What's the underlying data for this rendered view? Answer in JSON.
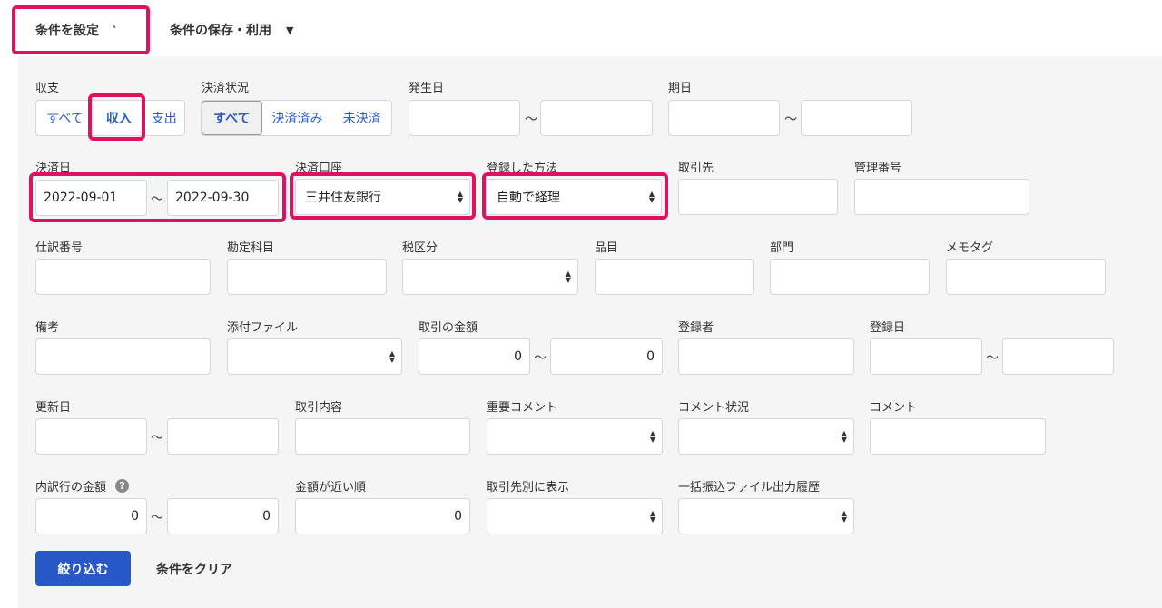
{
  "tabs": {
    "conditions": "条件を設定",
    "save_use": "条件の保存・利用"
  },
  "labels": {
    "income_expense": "収支",
    "settlement_status": "決済状況",
    "issue_date": "発生日",
    "due_date": "期日",
    "settlement_date": "決済日",
    "settlement_account": "決済口座",
    "registration_method": "登録した方法",
    "partner": "取引先",
    "management_no": "管理番号",
    "journal_no": "仕訳番号",
    "account_item": "勘定科目",
    "tax_category": "税区分",
    "item": "品目",
    "department": "部門",
    "memo_tag": "メモタグ",
    "remarks": "備考",
    "attachment": "添付ファイル",
    "amount": "取引の金額",
    "registrant": "登録者",
    "registered_date": "登録日",
    "updated_date": "更新日",
    "transaction_content": "取引内容",
    "important_comment": "重要コメント",
    "comment_status": "コメント状況",
    "comment": "コメント",
    "breakdown_amount": "内訳行の金額",
    "amount_nearest": "金額が近い順",
    "by_partner": "取引先別に表示",
    "bulk_transfer_history": "一括振込ファイル出力履歴"
  },
  "income_expense_options": [
    "すべて",
    "収入",
    "支出"
  ],
  "settlement_status_options": [
    "すべて",
    "決済済み",
    "未決済"
  ],
  "values": {
    "settlement_date_from": "2022-09-01",
    "settlement_date_to": "2022-09-30",
    "settlement_account": "三井住友銀行",
    "registration_method": "自動で経理",
    "amount_from": "0",
    "amount_to": "0",
    "breakdown_from": "0",
    "breakdown_to": "0",
    "amount_nearest": "0"
  },
  "tilde": "〜",
  "help_glyph": "?",
  "buttons": {
    "filter": "絞り込む",
    "clear": "条件をクリア"
  },
  "colors": {
    "highlight": "#e0115f",
    "primary": "#2858c8",
    "link": "#2a5cc9"
  }
}
